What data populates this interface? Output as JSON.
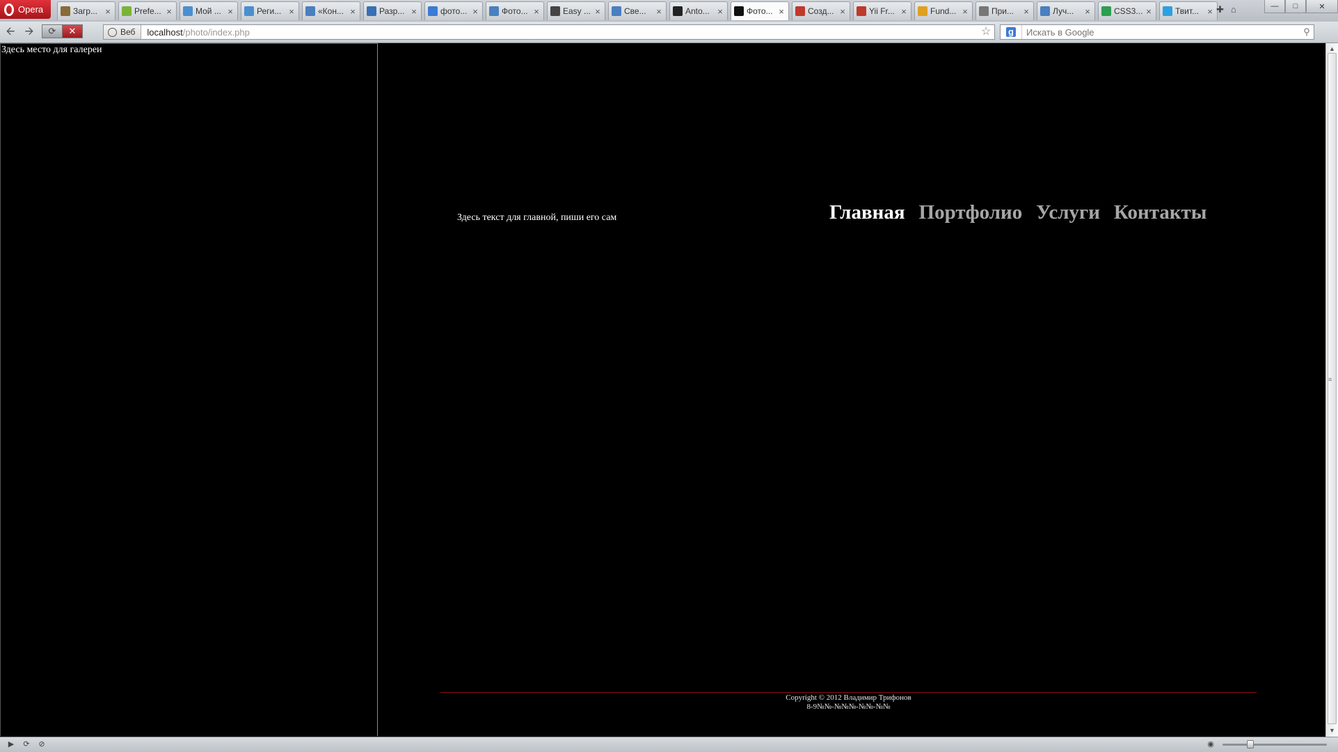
{
  "browser": {
    "name": "Opera",
    "tabs": [
      {
        "title": "Загр...",
        "fav_color": "#8a6a3a",
        "active": false
      },
      {
        "title": "Prefe...",
        "fav_color": "#7bb33a",
        "active": false
      },
      {
        "title": "Мой ...",
        "fav_color": "#4a8fd0",
        "active": false
      },
      {
        "title": "Реги...",
        "fav_color": "#4a8fd0",
        "active": false
      },
      {
        "title": "«Кон...",
        "fav_color": "#4a7fc0",
        "active": false
      },
      {
        "title": "Разр...",
        "fav_color": "#3a6fb5",
        "active": false
      },
      {
        "title": "фото...",
        "fav_color": "#3b7bd4",
        "active": false
      },
      {
        "title": "Фото...",
        "fav_color": "#4a7fc0",
        "active": false
      },
      {
        "title": "Easy ...",
        "fav_color": "#444444",
        "active": false
      },
      {
        "title": "Све...",
        "fav_color": "#4a7fc0",
        "active": false
      },
      {
        "title": "Anto...",
        "fav_color": "#222222",
        "active": false
      },
      {
        "title": "Фото...",
        "fav_color": "#111111",
        "active": true
      },
      {
        "title": "Созд...",
        "fav_color": "#c0392b",
        "active": false
      },
      {
        "title": "Yii Fr...",
        "fav_color": "#c0392b",
        "active": false
      },
      {
        "title": "Fund...",
        "fav_color": "#e0a020",
        "active": false
      },
      {
        "title": "При...",
        "fav_color": "#777777",
        "active": false
      },
      {
        "title": "Луч...",
        "fav_color": "#4a7fc0",
        "active": false
      },
      {
        "title": "CSS3...",
        "fav_color": "#2e9e4f",
        "active": false
      },
      {
        "title": "Твит...",
        "fav_color": "#2ea0e0",
        "active": false
      }
    ],
    "address": {
      "badge": "Веб",
      "host": "localhost",
      "path": "/photo/index.php"
    },
    "search": {
      "placeholder": "Искать в Google"
    }
  },
  "page": {
    "gallery_text": "Здесь место для галереи",
    "main_text": "Здесь текст для главной, пиши его сам",
    "menu": [
      {
        "label": "Главная",
        "current": true
      },
      {
        "label": "Портфолио",
        "current": false
      },
      {
        "label": "Услуги",
        "current": false
      },
      {
        "label": "Контакты",
        "current": false
      }
    ],
    "footer": {
      "copyright": "Copyright © 2012 Владимир Трифонов",
      "phone": "8-9№№-№№№-№№-№№"
    },
    "colors": {
      "background": "#000000",
      "menu_current": "#ffffff",
      "menu_other": "#a6a6a6",
      "footer_line": "#8c0d12"
    }
  }
}
